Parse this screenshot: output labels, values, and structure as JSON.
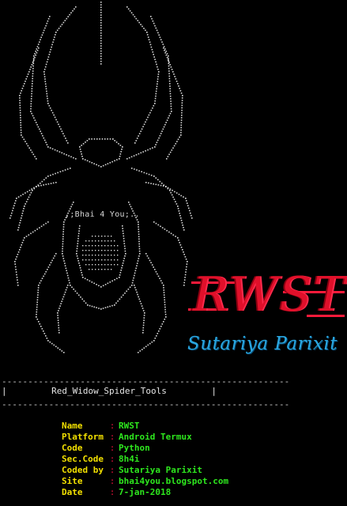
{
  "art": {
    "label": ",;Bhai 4 You;.."
  },
  "logo": {
    "text": "RWST",
    "subtitle": "Sutariya Parixit"
  },
  "divider": {
    "line": "-------------------------------------------------------"
  },
  "banner": {
    "left_bar": "|",
    "title": "Red_Widow_Spider_Tools",
    "right_bar": "|"
  },
  "info": {
    "separator": ":",
    "rows": [
      {
        "key": "Name",
        "value": "RWST"
      },
      {
        "key": "Platform",
        "value": "Android Termux"
      },
      {
        "key": "Code",
        "value": "Python"
      },
      {
        "key": "Sec.Code",
        "value": "8h4i"
      },
      {
        "key": "Coded by",
        "value": "Sutariya Parixit"
      },
      {
        "key": "Site",
        "value": "bhai4you.blogspot.com"
      },
      {
        "key": "Date",
        "value": "7-jan-2018"
      }
    ]
  },
  "colors": {
    "background": "#000000",
    "art": "#d8d8d8",
    "logo_red": "#e0102a",
    "subtitle_blue": "#2aa7e0",
    "key_yellow": "#f2e000",
    "separator_red": "#e0103a",
    "value_green": "#2ee81e"
  }
}
